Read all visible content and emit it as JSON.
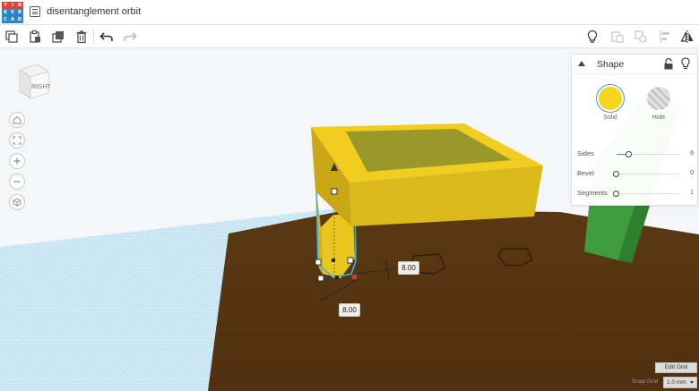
{
  "app": {
    "logo_letters": [
      "T",
      "I",
      "N",
      "K",
      "E",
      "R",
      "C",
      "A",
      "D"
    ],
    "logo_colors": [
      "#e3403a",
      "#e3403a",
      "#e3403a",
      "#2a86c9",
      "#2a86c9",
      "#2a86c9",
      "#2a86c9",
      "#2a86c9",
      "#2a86c9"
    ],
    "design_title": "disentanglement orbit"
  },
  "toolbar": {
    "left_icons": [
      "copy-icon",
      "paste-icon",
      "duplicate-icon",
      "delete-icon",
      "undo-icon",
      "redo-icon"
    ],
    "right_icons": [
      "lightbulb-icon",
      "group-icon",
      "ungroup-icon",
      "align-icon",
      "mirror-icon"
    ]
  },
  "viewport": {
    "view_cube_label": "RIGHT",
    "nav_icons": [
      "home-icon",
      "fit-view-icon",
      "zoom-in-icon",
      "zoom-out-icon",
      "perspective-icon"
    ],
    "dim_width": "8.00",
    "dim_depth": "8.00",
    "colors": {
      "grid": "#b9dcf0",
      "workplane": "#5a3714",
      "shape_yellow": "#e7c31d",
      "shape_green": "#3d9a3d",
      "selection": "#38b4e0"
    }
  },
  "shape_panel": {
    "title": "Shape",
    "solid_label": "Solid",
    "hole_label": "Hole",
    "sliders": [
      {
        "label": "Sides",
        "value": "6",
        "level": 0.2
      },
      {
        "label": "Bevel",
        "value": "0",
        "level": 0
      },
      {
        "label": "Segments",
        "value": "1",
        "level": 0
      }
    ]
  },
  "grid_controls": {
    "edit_grid": "Edit Grid",
    "snap_label": "Snap Grid",
    "snap_value": "1.0 mm"
  }
}
